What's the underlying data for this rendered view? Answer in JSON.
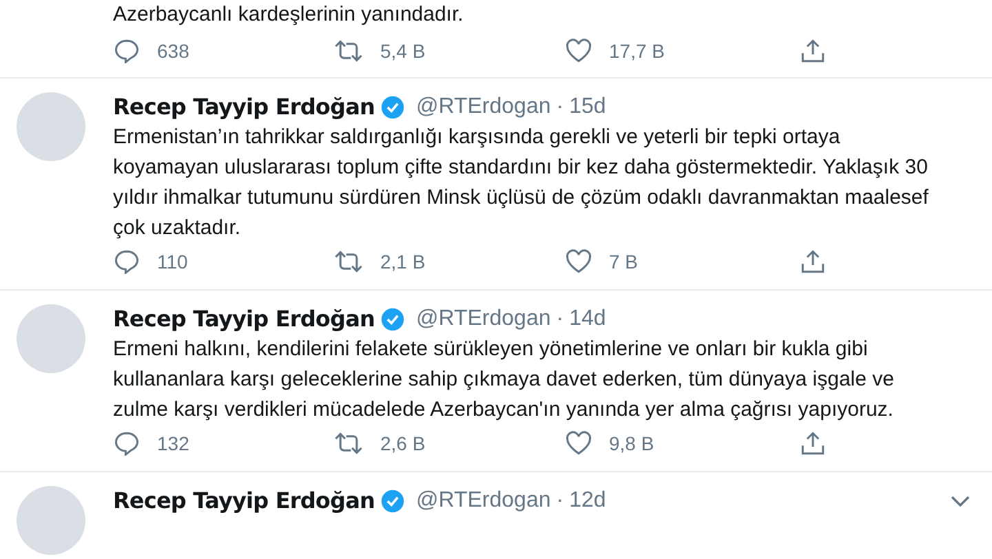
{
  "top_tweet": {
    "text": "Azerbaycanlı kardeşlerinin yanındadır.",
    "replies": "638",
    "retweets": "5,4 B",
    "likes": "17,7 B"
  },
  "tweets": [
    {
      "name": "Recep Tayyip Erdoğan",
      "handle": "@RTErdogan",
      "separator": "·",
      "time": "15d",
      "text": "Ermenistan’ın tahrikkar saldırganlığı karşısında gerekli ve yeterli bir tepki ortaya koyamayan uluslararası toplum çifte standardını bir kez daha göstermektedir. Yaklaşık 30 yıldır ihmalkar tutumunu sürdüren Minsk üçlüsü de çözüm odaklı davranmaktan maalesef çok uzaktadır.",
      "replies": "110",
      "retweets": "2,1 B",
      "likes": "7 B"
    },
    {
      "name": "Recep Tayyip Erdoğan",
      "handle": "@RTErdogan",
      "separator": "·",
      "time": "14d",
      "text": "Ermeni halkını, kendilerini felakete sürükleyen yönetimlerine ve onları bir kukla gibi kullananlara karşı geleceklerine sahip çıkmaya davet ederken, tüm dünyaya işgale ve zulme karşı verdikleri mücadelede Azerbaycan'ın yanında yer alma çağrısı yapıyoruz.",
      "replies": "132",
      "retweets": "2,6 B",
      "likes": "9,8 B"
    }
  ],
  "cut_tweet": {
    "name": "Recep Tayyip Erdoğan",
    "handle": "@RTErdogan",
    "separator": "·",
    "time": "12d"
  }
}
